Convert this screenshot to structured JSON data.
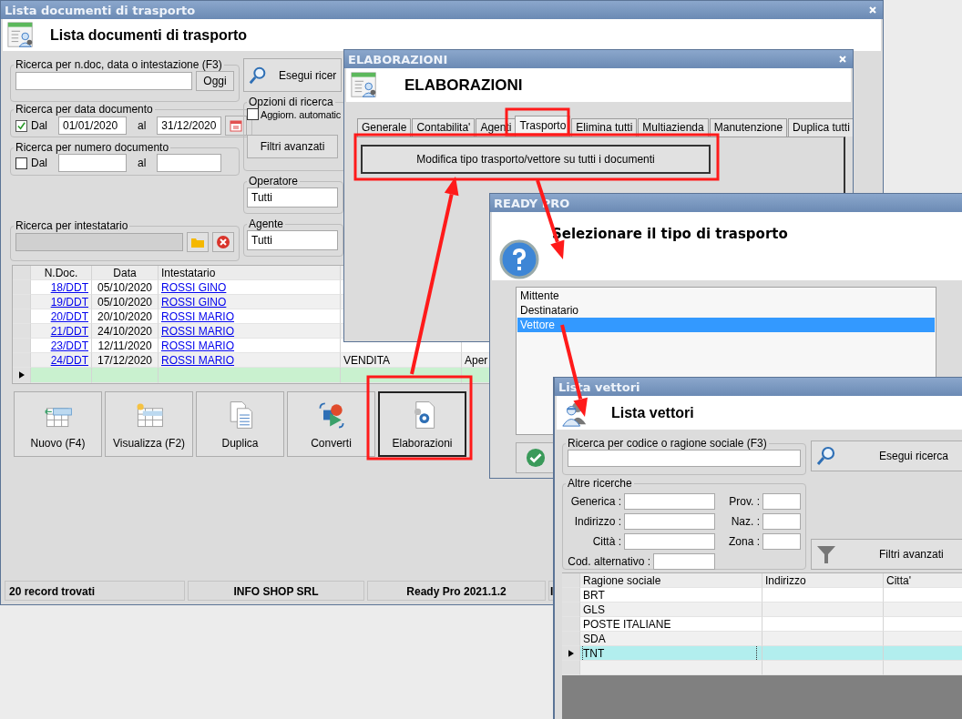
{
  "main_window": {
    "title": "Lista documenti di trasporto",
    "heading": "Lista documenti di trasporto",
    "text_search": {
      "legend": "Ricerca per n.doc, data o intestazione (F3)",
      "button": "Oggi"
    },
    "date_search": {
      "legend": "Ricerca per data documento",
      "checkbox": {
        "label": "Dal",
        "checked": true
      },
      "from": "01/01/2020",
      "to_label": "al",
      "to": "31/12/2020"
    },
    "number_search": {
      "legend": "Ricerca per numero documento",
      "checkbox": {
        "label": "Dal",
        "checked": false
      },
      "to_label": "al"
    },
    "holder_search": {
      "legend": "Ricerca per intestatario"
    },
    "search_button": "Esegui ricer",
    "options": {
      "legend": "Opzioni di ricerca",
      "checkbox": {
        "label": "Aggiorn. automatic",
        "checked": false
      },
      "button": "Filtri avanzati"
    },
    "operator": {
      "legend": "Operatore",
      "value": "Tutti"
    },
    "agent": {
      "legend": "Agente",
      "value": "Tutti"
    },
    "table": {
      "columns": [
        "N.Doc.",
        "Data",
        "Intestatario"
      ],
      "rows": [
        {
          "number": "18/DDT",
          "date": "05/10/2020",
          "holder": "ROSSI GINO"
        },
        {
          "number": "19/DDT",
          "date": "05/10/2020",
          "holder": "ROSSI GINO"
        },
        {
          "number": "20/DDT",
          "date": "20/10/2020",
          "holder": "ROSSI MARIO"
        },
        {
          "number": "21/DDT",
          "date": "24/10/2020",
          "holder": "ROSSI MARIO"
        },
        {
          "number": "23/DDT",
          "date": "12/11/2020",
          "holder": "ROSSI MARIO"
        },
        {
          "number": "24/DDT",
          "date": "17/12/2020",
          "holder": "ROSSI MARIO",
          "column_4": "VENDITA",
          "column_5": "Aper"
        }
      ]
    },
    "buttons": [
      {
        "label": "Nuovo (F4)",
        "kind": "new",
        "focused": false
      },
      {
        "label": "Visualizza (F2)",
        "kind": "view",
        "focused": false
      },
      {
        "label": "Duplica",
        "kind": "duplicate",
        "focused": false
      },
      {
        "label": "Converti",
        "kind": "convert",
        "focused": false
      },
      {
        "label": "Elaborazioni",
        "kind": "process",
        "focused": true
      }
    ],
    "status_bar": [
      "20 record trovati",
      "INFO SHOP SRL",
      "Ready Pro 2021.1.2",
      "I"
    ]
  },
  "processing_window": {
    "title": "ELABORAZIONI",
    "heading": "ELABORAZIONI",
    "tabs": [
      {
        "label": "Generale",
        "selected": false
      },
      {
        "label": "Contabilita'",
        "selected": false
      },
      {
        "label": "Agenti",
        "selected": false
      },
      {
        "label": "Trasporto",
        "selected": true
      },
      {
        "label": "Elimina tutti",
        "selected": false
      },
      {
        "label": "Multiazienda",
        "selected": false
      },
      {
        "label": "Manutenzione",
        "selected": false
      },
      {
        "label": "Duplica tutti",
        "selected": false
      }
    ],
    "action_button": "Modifica tipo trasporto/vettore su tutti i documenti"
  },
  "dialog": {
    "title": "READY PRO",
    "message": "Selezionare il tipo di trasporto",
    "options": [
      {
        "label": "Mittente",
        "selected": false
      },
      {
        "label": "Destinatario",
        "selected": false
      },
      {
        "label": "Vettore",
        "selected": true
      }
    ]
  },
  "carriers_window": {
    "title": "Lista vettori",
    "heading": "Lista vettori",
    "search": {
      "legend": "Ricerca per codice o ragione sociale (F3)"
    },
    "search_button": "Esegui ricerca",
    "other_search": {
      "legend": "Altre ricerche",
      "left_fields": [
        "Generica :",
        "Indirizzo :",
        "Città :",
        "Cod. alternativo :"
      ],
      "right_fields": [
        "Prov. :",
        "Naz. :",
        "Zona :"
      ]
    },
    "filter_button": "Filtri avanzati",
    "table": {
      "columns": [
        "Ragione sociale",
        "Indirizzo",
        "Citta'"
      ],
      "rows": [
        {
          "name": "BRT",
          "selected": false
        },
        {
          "name": "GLS",
          "selected": false
        },
        {
          "name": "POSTE ITALIANE",
          "selected": false
        },
        {
          "name": "SDA",
          "selected": false
        },
        {
          "name": "TNT",
          "selected": true
        }
      ]
    }
  }
}
